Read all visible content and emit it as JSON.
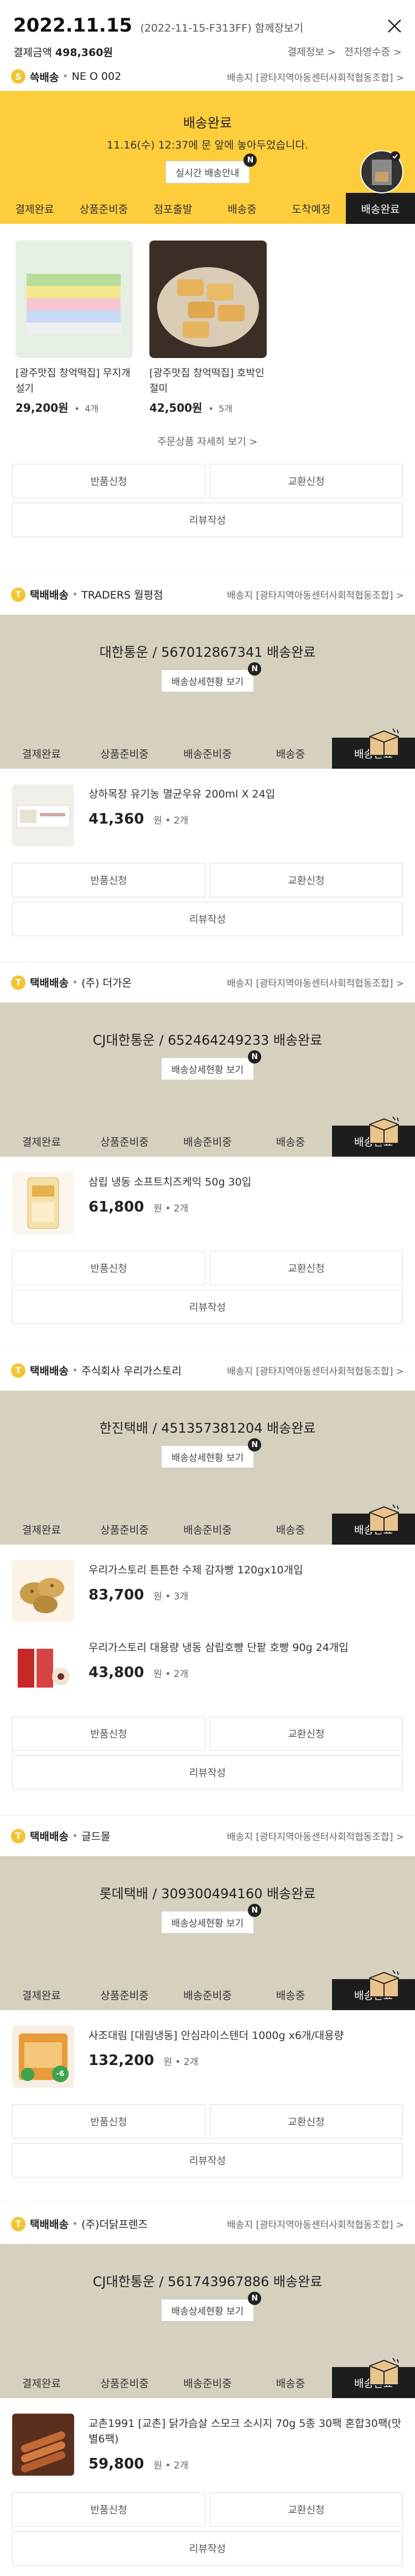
{
  "header": {
    "date": "2022.11.15",
    "order_no": "(2022-11-15-F313FF) 함께장보기",
    "pay_label": "결제금액",
    "pay_amount": "498,360원",
    "link_payinfo": "결제정보 >",
    "link_receipt": "전자영수증 >"
  },
  "steps": [
    "결제완료",
    "상품준비중",
    "점포출발",
    "배송중",
    "도착예정",
    "배송완료"
  ],
  "steps_courier": [
    "결제완료",
    "상품준비중",
    "배송준비중",
    "배송중",
    "배송완료"
  ],
  "common": {
    "detail_btn": "배송상세현황 보기",
    "return_btn": "반품신청",
    "exchange_btn": "교환신청",
    "review_btn": "리뷰작성",
    "n_badge": "N",
    "dest": "배송지 [광타지역아동센터사회적협동조합] >"
  },
  "sec1": {
    "type": "쓱배송",
    "code": "NE O 002",
    "status": "배송완료",
    "status_sub": "11.16(수) 12:37에 문 앞에 놓아두었습니다.",
    "btn": "실시간 배송안내",
    "products": [
      {
        "name": "[광주맛집 창억떡집] 무지개설기",
        "price": "29,200원",
        "qty": "4개"
      },
      {
        "name": "[광주맛집 창억떡집] 호박인절미",
        "price": "42,500원",
        "qty": "5개"
      }
    ],
    "more": "주문상품 자세히 보기 >"
  },
  "sections": [
    {
      "type": "택배배송",
      "seller": "TRADERS 월평점",
      "courier": "대한통운 / 567012867341 배송완료",
      "items": [
        {
          "name": "상하목장 유기농 멸균우유 200ml X 24입",
          "price": "41,360",
          "qty": "원 • 2개"
        }
      ]
    },
    {
      "type": "택배배송",
      "seller": "(주) 더가온",
      "courier": "CJ대한통운 / 652464249233 배송완료",
      "items": [
        {
          "name": "삼립 냉동 소프트치즈케익 50g 30입",
          "price": "61,800",
          "qty": "원 • 2개"
        }
      ]
    },
    {
      "type": "택배배송",
      "seller": "주식회사 우리가스토리",
      "courier": "한진택배 / 451357381204 배송완료",
      "items": [
        {
          "name": "우리가스토리 튼튼한 수제 감자빵 120gx10개입",
          "price": "83,700",
          "qty": "원 • 3개"
        },
        {
          "name": "우리가스토리 대용량 냉동 삼립호빵 단팥 호빵 90g 24개입",
          "price": "43,800",
          "qty": "원 • 2개"
        }
      ]
    },
    {
      "type": "택배배송",
      "seller": "글드몰",
      "courier": "롯데택배 / 309300494160 배송완료",
      "items": [
        {
          "name": "사조대림 [대림냉동] 안심라이스텐더 1000g x6개/대용량",
          "price": "132,200",
          "qty": "원 • 2개",
          "tag": "-6"
        }
      ]
    },
    {
      "type": "택배배송",
      "seller": "(주)더닭프렌즈",
      "courier": "CJ대한통운 / 561743967886 배송완료",
      "items": [
        {
          "name": "교촌1991 [교촌] 닭가슴살 스모크 소시지 70g 5종 30팩 혼합30팩(맛별6팩)",
          "price": "59,800",
          "qty": "원 • 2개"
        }
      ]
    }
  ],
  "colors": {
    "yellow": "#fecd3c",
    "beige": "#d6d1bf",
    "dark": "#1d1d1d"
  }
}
